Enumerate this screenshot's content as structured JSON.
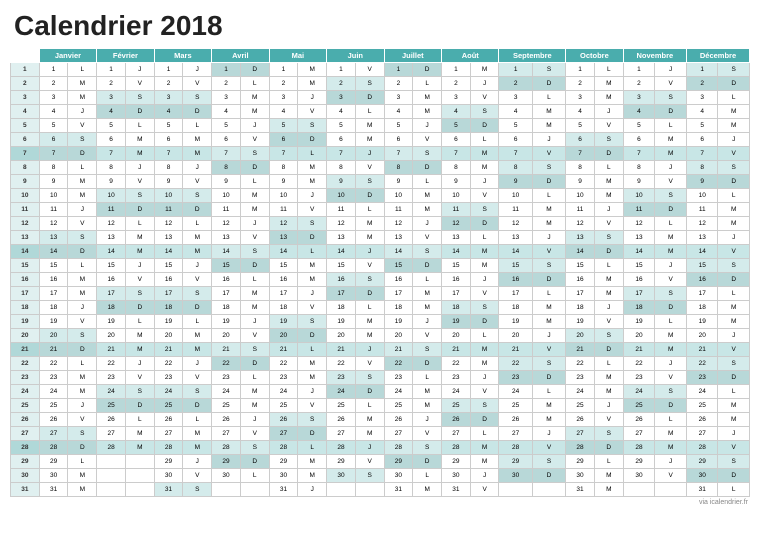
{
  "title": "Calendrier 2018",
  "months": [
    "Janvier",
    "Février",
    "Mars",
    "Avril",
    "Mai",
    "Juin",
    "Juillet",
    "Août",
    "Septembre",
    "Octobre",
    "Novembre",
    "Décembre"
  ],
  "footer": "via icalendrier.fr",
  "days": {
    "L": "L",
    "M": "M",
    "V": "V",
    "S": "S",
    "D": "D",
    "J": "J"
  }
}
